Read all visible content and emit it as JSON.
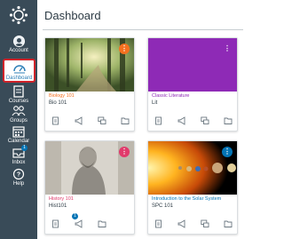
{
  "header": {
    "title": "Dashboard"
  },
  "nav": {
    "logo": "canvas-logo-icon",
    "items": [
      {
        "label": "Account",
        "icon": "avatar-icon"
      },
      {
        "label": "Dashboard",
        "icon": "dashboard-icon",
        "active": true
      },
      {
        "label": "Courses",
        "icon": "courses-icon"
      },
      {
        "label": "Groups",
        "icon": "groups-icon"
      },
      {
        "label": "Calendar",
        "icon": "calendar-icon"
      },
      {
        "label": "Inbox",
        "icon": "inbox-icon",
        "badge": "1"
      },
      {
        "label": "Help",
        "icon": "help-icon"
      }
    ]
  },
  "cards": [
    {
      "name": "Biology 101",
      "code": "Bio 101",
      "color": "#f4701f",
      "kebab_color": "#f4701f",
      "image": "forest-image"
    },
    {
      "name": "Classic Literature",
      "code": "Lit",
      "color": "#8e2ab6",
      "kebab_color": "transparent",
      "image": "purple-solid"
    },
    {
      "name": "History 101",
      "code": "Hist101",
      "color": "#e03a6b",
      "kebab_color": "#e03a6b",
      "image": "lincoln-image",
      "announcement_badge": "1"
    },
    {
      "name": "Introduction to the Solar System",
      "code": "SPC 101",
      "color": "#0374b5",
      "kebab_color": "#0374b5",
      "image": "solar-system-image"
    }
  ],
  "colors": {
    "nav_bg": "#394b58",
    "active_outline": "#d1232a",
    "accent": "#0374b5"
  }
}
